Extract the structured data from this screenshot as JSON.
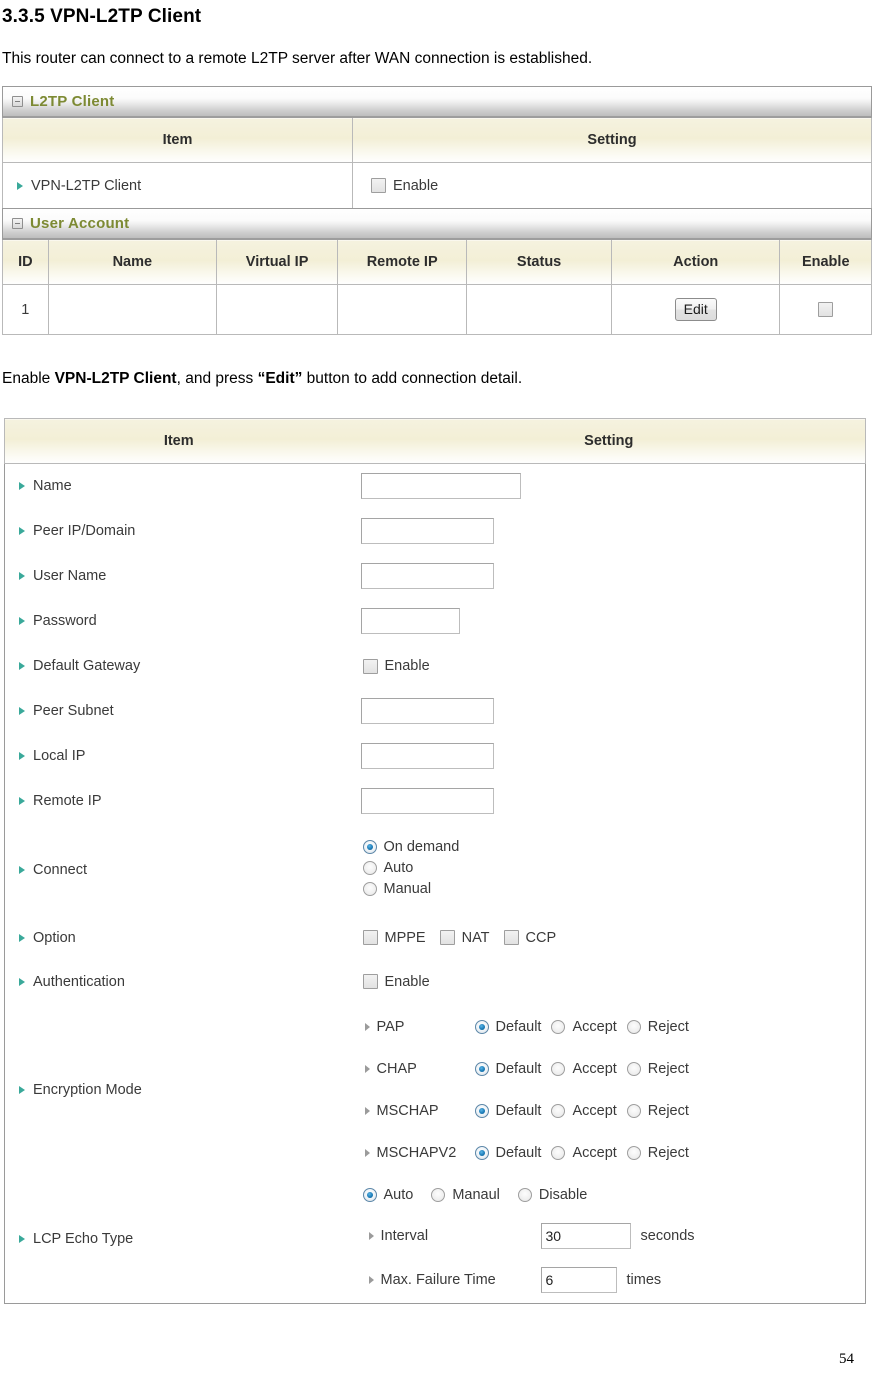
{
  "document": {
    "heading": "3.3.5 VPN-L2TP Client",
    "intro": "This router can connect to a remote L2TP server after WAN connection is established.",
    "instruction": {
      "prefix": "Enable ",
      "bold1": "VPN-L2TP Client",
      "middle": ", and press ",
      "bold2": "“Edit”",
      "suffix": " button to add connection detail."
    },
    "page_number": "54"
  },
  "colors": {
    "bullet_teal": "#3aa99a",
    "section_title_olive": "#7d8a33",
    "radio_blue": "#1878b4",
    "header_cream": "#f3efd6"
  },
  "panel_l2tp_client": {
    "section_title": "L2TP Client",
    "columns": {
      "item": "Item",
      "setting": "Setting"
    },
    "rows": [
      {
        "label": "VPN-L2TP Client",
        "control": "checkbox",
        "checked": false,
        "control_label": "Enable"
      }
    ]
  },
  "panel_user_account": {
    "section_title": "User Account",
    "columns": [
      "ID",
      "Name",
      "Virtual IP",
      "Remote IP",
      "Status",
      "Action",
      "Enable"
    ],
    "rows": [
      {
        "id": "1",
        "name": "",
        "virtual_ip": "",
        "remote_ip": "",
        "status": "",
        "action_label": "Edit",
        "enable_checked": false
      }
    ]
  },
  "panel_connection_detail": {
    "columns": {
      "item": "Item",
      "setting": "Setting"
    },
    "fields": {
      "name": {
        "label": "Name",
        "value": "",
        "placeholder": ""
      },
      "peer_ip_domain": {
        "label": "Peer IP/Domain",
        "value": "",
        "placeholder": ""
      },
      "user_name": {
        "label": "User Name",
        "value": "",
        "placeholder": ""
      },
      "password": {
        "label": "Password",
        "value": "",
        "placeholder": ""
      },
      "default_gateway": {
        "label": "Default Gateway",
        "checkbox_label": "Enable",
        "checked": false
      },
      "peer_subnet": {
        "label": "Peer Subnet",
        "value": "",
        "placeholder": ""
      },
      "local_ip": {
        "label": "Local IP",
        "value": "",
        "placeholder": ""
      },
      "remote_ip": {
        "label": "Remote IP",
        "value": "",
        "placeholder": ""
      },
      "connect": {
        "label": "Connect",
        "options": [
          "On demand",
          "Auto",
          "Manual"
        ],
        "selected": "On demand"
      },
      "option": {
        "label": "Option",
        "checkboxes": [
          {
            "label": "MPPE",
            "checked": false
          },
          {
            "label": "NAT",
            "checked": false
          },
          {
            "label": "CCP",
            "checked": false
          }
        ]
      },
      "authentication": {
        "label": "Authentication",
        "checkbox_label": "Enable",
        "checked": false
      },
      "encryption_mode": {
        "label": "Encryption Mode",
        "options": [
          "Default",
          "Accept",
          "Reject"
        ],
        "protocols": [
          {
            "name": "PAP",
            "selected": "Default"
          },
          {
            "name": "CHAP",
            "selected": "Default"
          },
          {
            "name": "MSCHAP",
            "selected": "Default"
          },
          {
            "name": "MSCHAPV2",
            "selected": "Default"
          }
        ]
      },
      "lcp_echo_type": {
        "label": "LCP Echo Type",
        "modes": [
          "Auto",
          "Manaul",
          "Disable"
        ],
        "selected_mode": "Auto",
        "interval": {
          "label": "Interval",
          "value": "30",
          "unit": "seconds"
        },
        "max_failure_time": {
          "label": "Max. Failure Time",
          "value": "6",
          "unit": "times"
        }
      }
    }
  }
}
